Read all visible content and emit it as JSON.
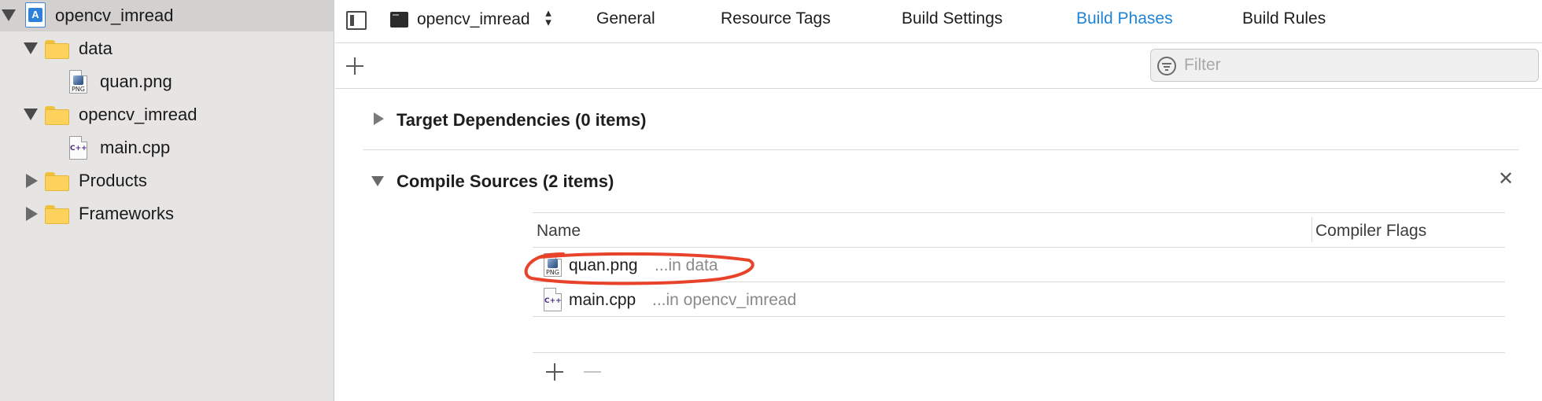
{
  "navigator": {
    "project": {
      "name": "opencv_imread",
      "icon": "xcode-project-icon"
    },
    "items": [
      {
        "label": "data",
        "type": "folder",
        "expanded": true,
        "icon": "folder-icon"
      },
      {
        "label": "quan.png",
        "type": "file",
        "icon": "png-file-icon",
        "badge": "PNG"
      },
      {
        "label": "opencv_imread",
        "type": "folder",
        "expanded": true,
        "icon": "folder-icon"
      },
      {
        "label": "main.cpp",
        "type": "file",
        "icon": "cpp-file-icon",
        "badge": "C++"
      },
      {
        "label": "Products",
        "type": "folder",
        "expanded": false,
        "icon": "folder-icon"
      },
      {
        "label": "Frameworks",
        "type": "folder",
        "expanded": false,
        "icon": "folder-icon"
      }
    ]
  },
  "topbar": {
    "target": "opencv_imread",
    "tabs": [
      "General",
      "Resource Tags",
      "Build Settings",
      "Build Phases",
      "Build Rules"
    ],
    "active_tab": "Build Phases"
  },
  "filter": {
    "placeholder": "Filter",
    "value": ""
  },
  "phases": {
    "target_dependencies": {
      "title": "Target Dependencies (0 items)",
      "expanded": false
    },
    "compile_sources": {
      "title": "Compile Sources (2 items)",
      "expanded": true,
      "columns": [
        "Name",
        "Compiler Flags"
      ],
      "rows": [
        {
          "name": "quan.png",
          "location": "...in data",
          "icon": "png-file-icon",
          "badge": "PNG",
          "highlighted": true
        },
        {
          "name": "main.cpp",
          "location": "...in opencv_imread",
          "icon": "cpp-file-icon",
          "badge": "C++",
          "highlighted": false
        }
      ]
    }
  },
  "colors": {
    "accent": "#1f84d6",
    "sidebar_bg": "#e6e5e4",
    "selection": "#d2d1d0",
    "annotation": "#e8432a",
    "folder": "#fcd25c"
  }
}
